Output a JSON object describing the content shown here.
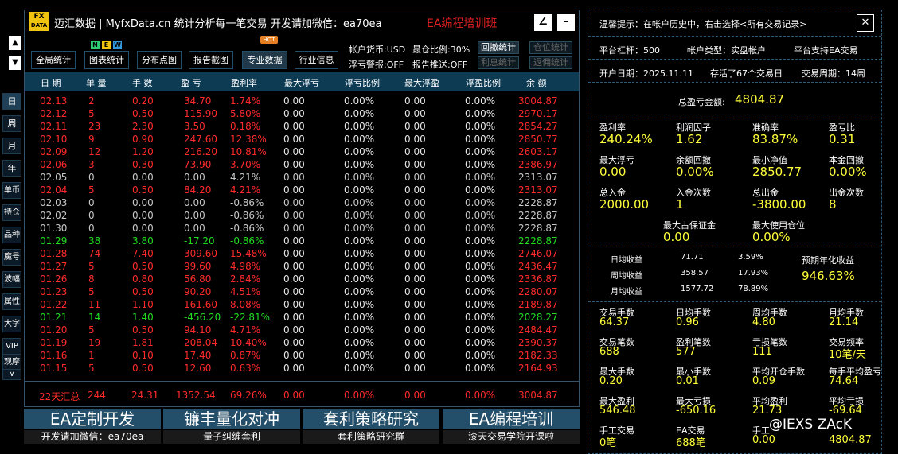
{
  "header": {
    "logo_top": "FX",
    "logo_bottom": "DATA",
    "title": "迈汇数据 | MyfxData.cn  统计分析每一笔交易",
    "contact": "开发请加微信：ea70ea",
    "promo": "EA编程培训班"
  },
  "leftnav": {
    "up": "▲",
    "down": "▼",
    "buttons": [
      "日",
      "周",
      "月",
      "年",
      "单币",
      "持仓",
      "品种",
      "魔号",
      "波幅",
      "属性",
      "大字",
      "VIP",
      "观摩",
      "∨"
    ]
  },
  "tabs": [
    {
      "label": "全局统计"
    },
    {
      "label": "图表统计"
    },
    {
      "label": "分布点图"
    },
    {
      "label": "报告截图"
    },
    {
      "label": "专业数据"
    },
    {
      "label": "行业信息"
    }
  ],
  "badges": {
    "n": "N",
    "e": "E",
    "w": "W",
    "hot": "HOT"
  },
  "account_info": {
    "currency": "帐户货币:USD",
    "position_ratio": "最仓比例:30%",
    "float_alert": "浮亏警报:OFF",
    "report_push": "报告推送:OFF",
    "btn_withdraw_stats": "回撤统计",
    "btn_position_stats": "仓位统计",
    "btn_interest_stats": "利息统计",
    "btn_rebate_stats": "返佣统计"
  },
  "table": {
    "columns": [
      "日 期",
      "单 量",
      "手 数",
      "盈 亏",
      "盈利率",
      "最大浮亏",
      "浮亏比例",
      "最大浮盈",
      "浮盈比例",
      "余 额"
    ],
    "rows": [
      {
        "c": "red",
        "v": [
          "02.13",
          "2",
          "0.20",
          "34.70",
          "1.74%",
          "0.00",
          "0.00%",
          "0.00",
          "0.00%",
          "3004.87"
        ]
      },
      {
        "c": "red",
        "v": [
          "02.12",
          "5",
          "0.50",
          "115.90",
          "5.80%",
          "0.00",
          "0.00%",
          "0.00",
          "0.00%",
          "2970.17"
        ]
      },
      {
        "c": "red",
        "v": [
          "02.11",
          "23",
          "2.30",
          "3.50",
          "0.18%",
          "0.00",
          "0.00%",
          "0.00",
          "0.00%",
          "2854.27"
        ]
      },
      {
        "c": "red",
        "v": [
          "02.10",
          "9",
          "0.90",
          "247.60",
          "12.38%",
          "0.00",
          "0.00%",
          "0.00",
          "0.00%",
          "2850.77"
        ]
      },
      {
        "c": "red",
        "v": [
          "02.09",
          "12",
          "1.20",
          "216.20",
          "10.81%",
          "0.00",
          "0.00%",
          "0.00",
          "0.00%",
          "2603.17"
        ]
      },
      {
        "c": "red",
        "v": [
          "02.06",
          "3",
          "0.30",
          "73.90",
          "3.70%",
          "0.00",
          "0.00%",
          "0.00",
          "0.00%",
          "2386.97"
        ]
      },
      {
        "c": "gray",
        "v": [
          "02.05",
          "0",
          "0.00",
          "0.00",
          "4.21%",
          "0.00",
          "0.00%",
          "0.00",
          "0.00%",
          "2313.07"
        ]
      },
      {
        "c": "red",
        "v": [
          "02.04",
          "5",
          "0.50",
          "84.20",
          "4.21%",
          "0.00",
          "0.00%",
          "0.00",
          "0.00%",
          "2313.07"
        ]
      },
      {
        "c": "gray",
        "v": [
          "02.03",
          "0",
          "0.00",
          "0.00",
          "-0.86%",
          "0.00",
          "0.00%",
          "0.00",
          "0.00%",
          "2228.87"
        ]
      },
      {
        "c": "gray",
        "v": [
          "02.02",
          "0",
          "0.00",
          "0.00",
          "-0.86%",
          "0.00",
          "0.00%",
          "0.00",
          "0.00%",
          "2228.87"
        ]
      },
      {
        "c": "gray",
        "v": [
          "01.30",
          "0",
          "0.00",
          "0.00",
          "-0.86%",
          "0.00",
          "0.00%",
          "0.00",
          "0.00%",
          "2228.87"
        ]
      },
      {
        "c": "green",
        "v": [
          "01.29",
          "38",
          "3.80",
          "-17.20",
          "-0.86%",
          "0.00",
          "0.00%",
          "0.00",
          "0.00%",
          "2228.87"
        ]
      },
      {
        "c": "red",
        "v": [
          "01.28",
          "74",
          "7.40",
          "309.60",
          "15.48%",
          "0.00",
          "0.00%",
          "0.00",
          "0.00%",
          "2746.07"
        ]
      },
      {
        "c": "red",
        "v": [
          "01.27",
          "5",
          "0.50",
          "99.60",
          "4.98%",
          "0.00",
          "0.00%",
          "0.00",
          "0.00%",
          "2436.47"
        ]
      },
      {
        "c": "red",
        "v": [
          "01.26",
          "8",
          "0.80",
          "56.80",
          "2.84%",
          "0.00",
          "0.00%",
          "0.00",
          "0.00%",
          "2336.87"
        ]
      },
      {
        "c": "red",
        "v": [
          "01.23",
          "5",
          "0.50",
          "90.20",
          "4.51%",
          "0.00",
          "0.00%",
          "0.00",
          "0.00%",
          "2280.07"
        ]
      },
      {
        "c": "red",
        "v": [
          "01.22",
          "11",
          "1.10",
          "161.60",
          "8.08%",
          "0.00",
          "0.00%",
          "0.00",
          "0.00%",
          "2189.87"
        ]
      },
      {
        "c": "green",
        "v": [
          "01.21",
          "14",
          "1.40",
          "-456.20",
          "-22.81%",
          "0.00",
          "0.00%",
          "0.00",
          "0.00%",
          "2028.27"
        ]
      },
      {
        "c": "red",
        "v": [
          "01.20",
          "5",
          "0.50",
          "94.10",
          "4.71%",
          "0.00",
          "0.00%",
          "0.00",
          "0.00%",
          "2484.47"
        ]
      },
      {
        "c": "red",
        "v": [
          "01.19",
          "19",
          "1.81",
          "208.04",
          "10.40%",
          "0.00",
          "0.00%",
          "0.00",
          "0.00%",
          "2390.37"
        ]
      },
      {
        "c": "red",
        "v": [
          "01.16",
          "1",
          "0.10",
          "17.40",
          "0.87%",
          "0.00",
          "0.00%",
          "0.00",
          "0.00%",
          "2182.33"
        ]
      },
      {
        "c": "red",
        "v": [
          "01.15",
          "5",
          "0.50",
          "12.60",
          "0.63%",
          "0.00",
          "0.00%",
          "0.00",
          "0.00%",
          "2164.93"
        ]
      }
    ],
    "summary": [
      "22天汇总",
      "244",
      "24.31",
      "1352.54",
      "69.26%",
      "0.00",
      "0.00%",
      "0.00",
      "0.00%",
      "3004.87"
    ]
  },
  "banners": [
    {
      "big": "EA定制开发",
      "small": "开发请加微信：ea70ea"
    },
    {
      "big": "镰丰量化对冲",
      "small": "量子纠缠套利"
    },
    {
      "big": "套利策略研究",
      "small": "套利策略研究群"
    },
    {
      "big": "EA编程培训",
      "small": "漆天交易学院开课啦"
    }
  ],
  "right": {
    "tip": "温馨提示：在帐户历史中，右击选择<所有交易记录>",
    "close": "✕",
    "leverage": "平台杠杆：500",
    "acct_type": "帐户类型：实盘帐户",
    "platform": "平台支持EA交易",
    "open_date": "开户日期：2025.11.11",
    "alive": "存活了67个交易日",
    "cycle": "交易周期：14周",
    "total_pl_label": "总盈亏金额:",
    "total_pl": "4804.87",
    "metrics": [
      {
        "l": "盈利率",
        "v": "240.24%"
      },
      {
        "l": "利润因子",
        "v": "1.62"
      },
      {
        "l": "准确率",
        "v": "83.87%"
      },
      {
        "l": "盈亏比",
        "v": "0.31"
      },
      {
        "l": "最大浮亏",
        "v": "0.00"
      },
      {
        "l": "余额回撤",
        "v": "0.00%"
      },
      {
        "l": "最小净值",
        "v": "2850.77"
      },
      {
        "l": "本金回撤",
        "v": "0.00%"
      },
      {
        "l": "总入金",
        "v": "2000.00"
      },
      {
        "l": "入金次数",
        "v": "1"
      },
      {
        "l": "总出金",
        "v": "-3800.00"
      },
      {
        "l": "出金次数",
        "v": "8"
      }
    ],
    "margin": [
      {
        "l": "最大占保证金",
        "v": "0.00"
      },
      {
        "l": "最大使用仓位",
        "v": "0.00%"
      }
    ],
    "returns": [
      {
        "l": "日均收益",
        "a": "71.71",
        "p": "3.59%"
      },
      {
        "l": "周均收益",
        "a": "358.57",
        "p": "17.93%"
      },
      {
        "l": "月均收益",
        "a": "1577.72",
        "p": "78.89%"
      }
    ],
    "annual_label": "预期年化收益",
    "annual": "946.63%",
    "stats": [
      {
        "l": "交易手数",
        "v": "64.37"
      },
      {
        "l": "日均手数",
        "v": "0.96"
      },
      {
        "l": "周均手数",
        "v": "4.80"
      },
      {
        "l": "月均手数",
        "v": "21.14"
      },
      {
        "l": "交易笔数",
        "v": "688"
      },
      {
        "l": "盈利笔数",
        "v": "577"
      },
      {
        "l": "亏损笔数",
        "v": "111"
      },
      {
        "l": "交易频率",
        "v": "10笔/天"
      },
      {
        "l": "最大手数",
        "v": "0.20"
      },
      {
        "l": "最小手数",
        "v": "0.01"
      },
      {
        "l": "平均开仓手数",
        "v": "0.09"
      },
      {
        "l": "每手平均盈亏",
        "v": "74.64"
      },
      {
        "l": "最大盈利",
        "v": "546.48"
      },
      {
        "l": "最大亏损",
        "v": "-650.16"
      },
      {
        "l": "平均盈利",
        "v": "21.73"
      },
      {
        "l": "平均亏损",
        "v": "-69.64"
      },
      {
        "l": "手工交易",
        "v": "0笔"
      },
      {
        "l": "EA交易",
        "v": "688笔"
      },
      {
        "l": "手工",
        "v": "0.00"
      },
      {
        "l": "",
        "v": "4804.87"
      }
    ],
    "watermark": "@IEXS ZAcK"
  }
}
